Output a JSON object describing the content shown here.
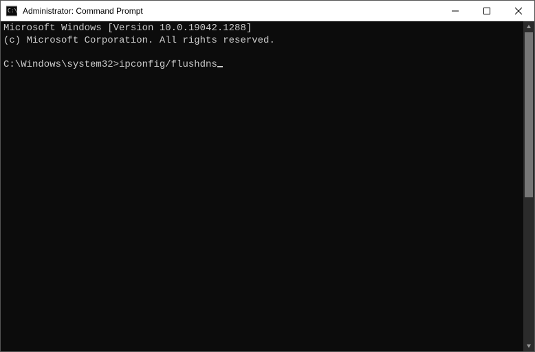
{
  "window": {
    "title": "Administrator: Command Prompt"
  },
  "terminal": {
    "line1": "Microsoft Windows [Version 10.0.19042.1288]",
    "line2": "(c) Microsoft Corporation. All rights reserved.",
    "blank": "",
    "prompt": "C:\\Windows\\system32>",
    "command": "ipconfig/flushdns"
  }
}
